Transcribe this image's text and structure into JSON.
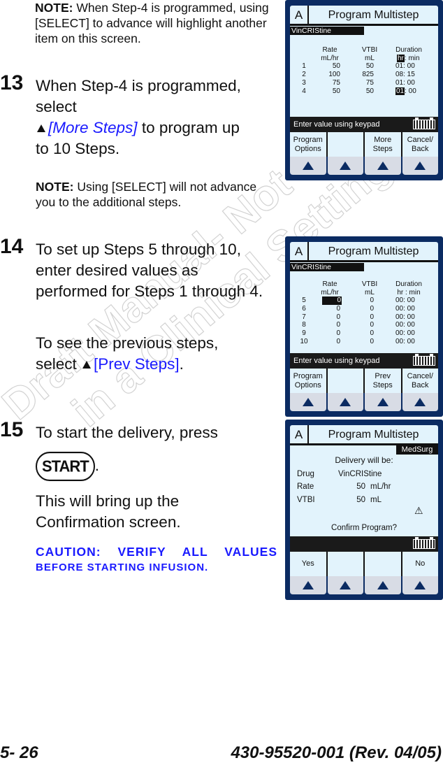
{
  "watermark": {
    "line1": "Draft Manual- Not to be used",
    "line2": "in a Clinical Setting."
  },
  "steps": {
    "note_top_label": "NOTE:",
    "note_top_text": " When Step-4 is programmed, using [SELECT] to advance will highlight another item on this screen.",
    "s13": {
      "num": "13",
      "line1": "When Step-4 is programmed,",
      "line2": "select",
      "link": "[More Steps]",
      "line3": " to program up",
      "line4": "to 10 Steps.",
      "note_label": "NOTE:",
      "note_text": " Using [SELECT] will not advance you to the additional steps."
    },
    "s14": {
      "num": "14",
      "text": "To set up Steps 5 through 10, enter desired values as performed for Steps 1 through 4.",
      "prev_pre": "To see the previous steps, select ",
      "link": "[Prev Steps]",
      "prev_post": "."
    },
    "s15": {
      "num": "15",
      "text": "To start the delivery, press",
      "start_key": "START",
      "after_key": ".",
      "text2": "This will bring up the Confirmation screen.",
      "caution1": "CAUTION:  VERIFY ALL VALUES",
      "caution2": "BEFORE STARTING INFUSION."
    }
  },
  "footer": {
    "page": "5- 26",
    "doc": "430-95520-001 (Rev. 04/05)"
  },
  "screen1": {
    "channel": "A",
    "title": "Program Multistep",
    "drug": "VinCRIStine",
    "headers": {
      "rate": "Rate",
      "rate_unit": "mL/hr",
      "vtbi": "VTBI",
      "vtbi_unit": "mL",
      "duration": "Duration",
      "dur_hr": "hr",
      "dur_min": ": min"
    },
    "rows": [
      {
        "step": "1",
        "rate": "50",
        "vtbi": "50",
        "hr": "01",
        "min": ": 00"
      },
      {
        "step": "2",
        "rate": "100",
        "vtbi": "825",
        "hr": "08",
        "min": ": 15"
      },
      {
        "step": "3",
        "rate": "75",
        "vtbi": "75",
        "hr": "01",
        "min": ": 00"
      },
      {
        "step": "4",
        "rate": "50",
        "vtbi": "50",
        "hr": "01",
        "min": ": 00"
      }
    ],
    "prompt": "Enter value using keypad",
    "softkeys": [
      "Program\nOptions",
      "",
      "More\nSteps",
      "Cancel/\nBack"
    ]
  },
  "screen2": {
    "channel": "A",
    "title": "Program Multistep",
    "drug": "VinCRIStine",
    "headers": {
      "rate": "Rate",
      "rate_unit": "mL/hr",
      "vtbi": "VTBI",
      "vtbi_unit": "mL",
      "duration": "Duration",
      "dur_unit": "hr : min"
    },
    "rows": [
      {
        "step": "5",
        "rate": "0",
        "vtbi": "0",
        "hr": "00",
        "min": ": 00"
      },
      {
        "step": "6",
        "rate": "0",
        "vtbi": "0",
        "hr": "00",
        "min": ": 00"
      },
      {
        "step": "7",
        "rate": "0",
        "vtbi": "0",
        "hr": "00",
        "min": ": 00"
      },
      {
        "step": "8",
        "rate": "0",
        "vtbi": "0",
        "hr": "00",
        "min": ": 00"
      },
      {
        "step": "9",
        "rate": "0",
        "vtbi": "0",
        "hr": "00",
        "min": ": 00"
      },
      {
        "step": "10",
        "rate": "0",
        "vtbi": "0",
        "hr": "00",
        "min": ": 00"
      }
    ],
    "prompt": "Enter value using keypad",
    "softkeys": [
      "Program\nOptions",
      "",
      "Prev\nSteps",
      "Cancel/\nBack"
    ]
  },
  "screen3": {
    "channel": "A",
    "title": "Program Multistep",
    "profile": "MedSurg",
    "heading": "Delivery will be:",
    "drug_label": "Drug",
    "drug_value": "VinCRIStine",
    "rate_label": "Rate",
    "rate_value": "50",
    "rate_unit": "mL/hr",
    "vtbi_label": "VTBI",
    "vtbi_value": "50",
    "vtbi_unit": "mL",
    "confirm": "Confirm Program?",
    "softkeys": [
      "Yes",
      "",
      "",
      "No"
    ]
  },
  "colors": {
    "frame": "#0b2b62",
    "screen_bg": "#e2f3fc",
    "link": "#1a1aff"
  }
}
